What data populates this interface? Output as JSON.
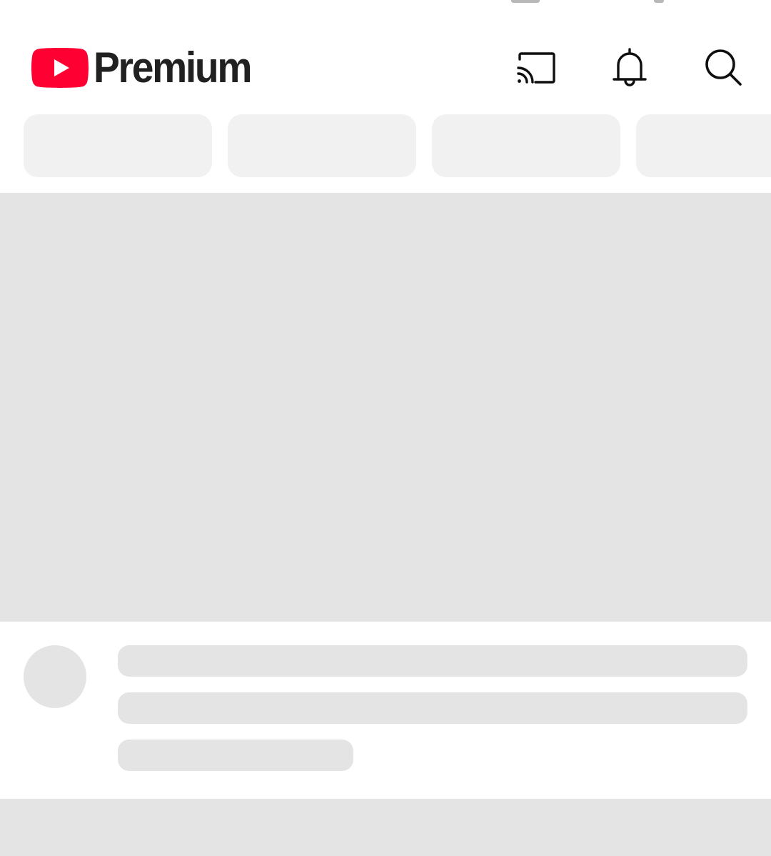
{
  "header": {
    "logo_text": "Premium",
    "brand_color": "#ff0033",
    "icons": {
      "cast": "cast-icon",
      "notifications": "bell-icon",
      "search": "search-icon"
    }
  },
  "chips": {
    "count_visible": 4,
    "state": "loading-placeholder"
  },
  "feed": {
    "state": "loading-placeholder",
    "placeholder_color": "#e4e4e4",
    "chip_placeholder_color": "#f1f1f1"
  }
}
